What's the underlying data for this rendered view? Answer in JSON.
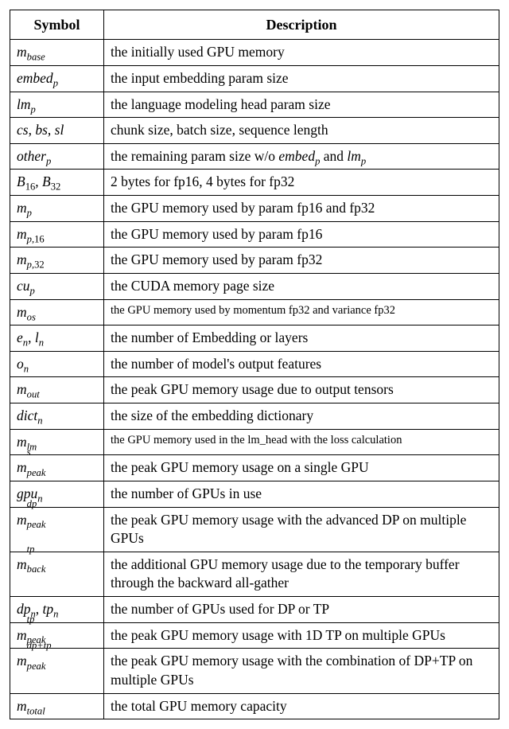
{
  "columns": {
    "symbol": "Symbol",
    "description": "Description"
  },
  "rows": [
    {
      "symbol_html": "m<sub>base</sub>",
      "description": "the initially used GPU memory"
    },
    {
      "symbol_html": "embed<sub>p</sub>",
      "description": "the input embedding param size"
    },
    {
      "symbol_html": "lm<sub>p</sub>",
      "description": "the language modeling head param size"
    },
    {
      "symbol_html": "cs<span class=\"rm\">, </span>bs<span class=\"rm\">, </span>sl",
      "description": "chunk size, batch size, sequence length"
    },
    {
      "symbol_html": "other<sub>p</sub>",
      "description_html": "the remaining param size w/o <span class=\"it\">embed<sub>p</sub></span> and <span class=\"it\">lm<sub>p</sub></span>"
    },
    {
      "symbol_html": "B<sub><span class=\"rm\">16</span></sub><span class=\"rm\">, </span>B<sub><span class=\"rm\">32</span></sub>",
      "description": "2 bytes for fp16, 4 bytes for fp32"
    },
    {
      "symbol_html": "m<sub>p</sub>",
      "description": "the GPU memory used by param fp16 and fp32"
    },
    {
      "symbol_html": "m<sub>p,<span class=\"rm\">16</span></sub>",
      "description": "the GPU memory used by param fp16"
    },
    {
      "symbol_html": "m<sub>p,<span class=\"rm\">32</span></sub>",
      "description": "the GPU memory used by param fp32"
    },
    {
      "symbol_html": "cu<sub>p</sub>",
      "description": "the CUDA memory page size"
    },
    {
      "symbol_html": "m<sub>os</sub>",
      "description": "the GPU memory used by momentum fp32 and variance fp32",
      "small": true
    },
    {
      "symbol_html": "e<sub>n</sub><span class=\"rm\">, </span>l<sub>n</sub>",
      "description": "the number of Embedding or layers"
    },
    {
      "symbol_html": "o<sub>n</sub>",
      "description": "the number of model's output features"
    },
    {
      "symbol_html": "m<sub>out</sub>",
      "description": "the peak GPU memory usage due to output tensors"
    },
    {
      "symbol_html": "dict<sub>n</sub>",
      "description": "the size of the embedding dictionary"
    },
    {
      "symbol_html": "m<sub>lm</sub>",
      "description": "the GPU memory used in the lm_head with the loss calculation",
      "small": true
    },
    {
      "symbol_html": "m<span class=\"subsup\"><sup>s</sup><sub>peak</sub></span>",
      "description": "the peak GPU memory usage on a single GPU"
    },
    {
      "symbol_html": "gpu<sub>n</sub>",
      "description": "the number of GPUs in use"
    },
    {
      "symbol_html": "m<span class=\"subsup\"><sup>dp</sup><sub>peak</sub></span>",
      "description": "the peak GPU memory usage with the advanced DP on multiple GPUs"
    },
    {
      "symbol_html": "m<span class=\"subsup\"><sup>tp</sup><sub>back</sub></span>",
      "description": "the additional GPU memory usage due to the temporary buffer through the backward all-gather"
    },
    {
      "symbol_html": "dp<sub>n</sub><span class=\"rm\">, </span>tp<sub>n</sub>",
      "description": "the number of GPUs used for DP or TP"
    },
    {
      "symbol_html": "m<span class=\"subsup\"><sup>tp</sup><sub>peak</sub></span>",
      "description": "the peak GPU memory usage with 1D TP on multiple GPUs"
    },
    {
      "symbol_html": "m<span class=\"subsup\"><sup>dp+tp</sup><sub>peak</sub></span>",
      "description": "the peak GPU memory usage with the combination of DP+TP on multiple GPUs"
    },
    {
      "symbol_html": "m<sub>total</sub>",
      "description": "the total GPU memory capacity"
    }
  ]
}
